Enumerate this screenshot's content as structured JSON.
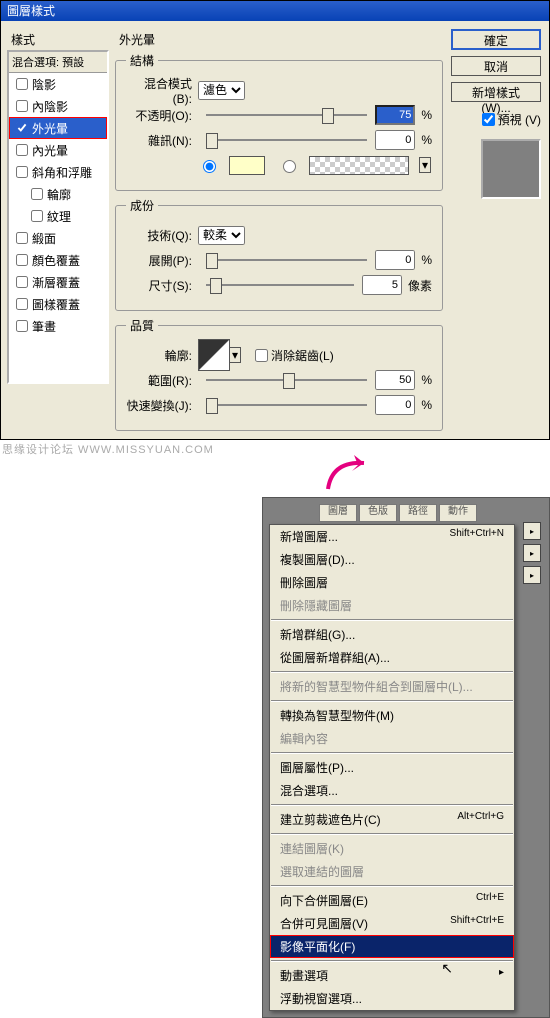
{
  "dialog": {
    "title": "圖層樣式",
    "styles_label": "樣式",
    "blend_head": "混合選項: 預設",
    "items": [
      {
        "label": "陰影",
        "indent": false,
        "checked": false
      },
      {
        "label": "內陰影",
        "indent": false,
        "checked": false
      },
      {
        "label": "外光暈",
        "indent": false,
        "checked": true,
        "selected": true
      },
      {
        "label": "內光暈",
        "indent": false,
        "checked": false
      },
      {
        "label": "斜角和浮雕",
        "indent": false,
        "checked": false
      },
      {
        "label": "輪廓",
        "indent": true,
        "checked": false
      },
      {
        "label": "紋理",
        "indent": true,
        "checked": false
      },
      {
        "label": "緞面",
        "indent": false,
        "checked": false
      },
      {
        "label": "顏色覆蓋",
        "indent": false,
        "checked": false
      },
      {
        "label": "漸層覆蓋",
        "indent": false,
        "checked": false
      },
      {
        "label": "圖樣覆蓋",
        "indent": false,
        "checked": false
      },
      {
        "label": "筆畫",
        "indent": false,
        "checked": false
      }
    ]
  },
  "panel": {
    "title": "外光暈",
    "group1": "結構",
    "blend_mode_label": "混合模式(B):",
    "blend_mode_value": "濾色",
    "opacity_label": "不透明(O):",
    "opacity_value": "75",
    "pct": "%",
    "noise_label": "雜訊(N):",
    "noise_value": "0",
    "color_swatch": "#FFFFC8",
    "group2": "成份",
    "tech_label": "技術(Q):",
    "tech_value": "較柔",
    "spread_label": "展開(P):",
    "spread_value": "0",
    "size_label": "尺寸(S):",
    "size_value": "5",
    "px": "像素",
    "group3": "品質",
    "contour_label": "輪廓:",
    "antialias_label": "消除鋸齒(L)",
    "range_label": "範圍(R):",
    "range_value": "50",
    "jitter_label": "快速變換(J):",
    "jitter_value": "0"
  },
  "buttons": {
    "ok": "確定",
    "cancel": "取消",
    "new_style": "新增樣式(W)...",
    "preview": "預視 (V)"
  },
  "watermark": "思缘设计论坛  WWW.MISSYUAN.COM",
  "menu": {
    "tabs": [
      "圖層",
      "色版",
      "路徑",
      "動作"
    ],
    "items": [
      {
        "label": "新增圖層...",
        "shortcut": "Shift+Ctrl+N"
      },
      {
        "label": "複製圖層(D)...",
        "shortcut": ""
      },
      {
        "label": "刪除圖層",
        "shortcut": ""
      },
      {
        "label": "刪除隱藏圖層",
        "shortcut": "",
        "dis": true
      },
      {
        "sep": true
      },
      {
        "label": "新增群組(G)...",
        "shortcut": ""
      },
      {
        "label": "從圖層新增群組(A)...",
        "shortcut": ""
      },
      {
        "sep": true
      },
      {
        "label": "將新的智慧型物件組合到圖層中(L)...",
        "shortcut": "",
        "dis": true
      },
      {
        "sep": true
      },
      {
        "label": "轉換為智慧型物件(M)",
        "shortcut": ""
      },
      {
        "label": "編輯內容",
        "shortcut": "",
        "dis": true
      },
      {
        "sep": true
      },
      {
        "label": "圖層屬性(P)...",
        "shortcut": ""
      },
      {
        "label": "混合選項...",
        "shortcut": ""
      },
      {
        "sep": true
      },
      {
        "label": "建立剪裁遮色片(C)",
        "shortcut": "Alt+Ctrl+G"
      },
      {
        "sep": true
      },
      {
        "label": "連結圖層(K)",
        "shortcut": "",
        "dis": true
      },
      {
        "label": "選取連結的圖層",
        "shortcut": "",
        "dis": true
      },
      {
        "sep": true
      },
      {
        "label": "向下合併圖層(E)",
        "shortcut": "Ctrl+E"
      },
      {
        "label": "合併可見圖層(V)",
        "shortcut": "Shift+Ctrl+E"
      },
      {
        "label": "影像平面化(F)",
        "shortcut": "",
        "hov": true
      },
      {
        "sep": true
      },
      {
        "label": "動畫選項",
        "shortcut": "",
        "sub": true
      },
      {
        "label": "浮動視窗選項...",
        "shortcut": ""
      }
    ]
  }
}
